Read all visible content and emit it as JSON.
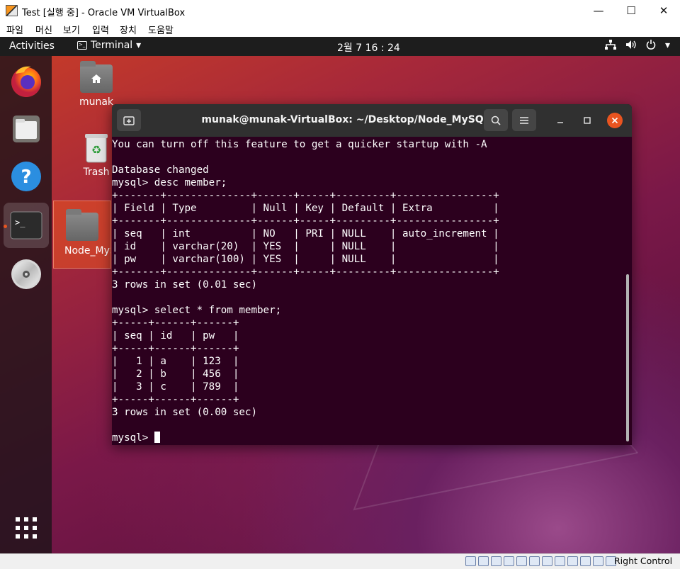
{
  "host": {
    "title": "Test [실행 중] - Oracle VM VirtualBox",
    "menu": [
      "파일",
      "머신",
      "보기",
      "입력",
      "장치",
      "도움말"
    ],
    "window_buttons": {
      "minimize": "—",
      "maximize": "☐",
      "close": "✕"
    },
    "status": {
      "host_key": "Right Control"
    }
  },
  "topbar": {
    "activities": "Activities",
    "app_menu": "Terminal",
    "clock": "2월 7  16 : 24"
  },
  "desktop": {
    "icons": [
      {
        "label": "munak"
      },
      {
        "label": "Trash"
      },
      {
        "label": "Node_MySQL"
      }
    ]
  },
  "terminal": {
    "title": "munak@munak-VirtualBox: ~/Desktop/Node_MySQL",
    "lines": [
      "You can turn off this feature to get a quicker startup with -A",
      "",
      "Database changed",
      "mysql> desc member;",
      "+-------+--------------+------+-----+---------+----------------+",
      "| Field | Type         | Null | Key | Default | Extra          |",
      "+-------+--------------+------+-----+---------+----------------+",
      "| seq   | int          | NO   | PRI | NULL    | auto_increment |",
      "| id    | varchar(20)  | YES  |     | NULL    |                |",
      "| pw    | varchar(100) | YES  |     | NULL    |                |",
      "+-------+--------------+------+-----+---------+----------------+",
      "3 rows in set (0.01 sec)",
      "",
      "mysql> select * from member;",
      "+-----+------+------+",
      "| seq | id   | pw   |",
      "+-----+------+------+",
      "|   1 | a    | 123  |",
      "|   2 | b    | 456  |",
      "|   3 | c    | 789  |",
      "+-----+------+------+",
      "3 rows in set (0.00 sec)",
      ""
    ],
    "prompt": "mysql> "
  },
  "colors": {
    "terminal_bg": "#2c001e",
    "ubuntu_orange": "#e95420",
    "header_bg": "#303030"
  }
}
